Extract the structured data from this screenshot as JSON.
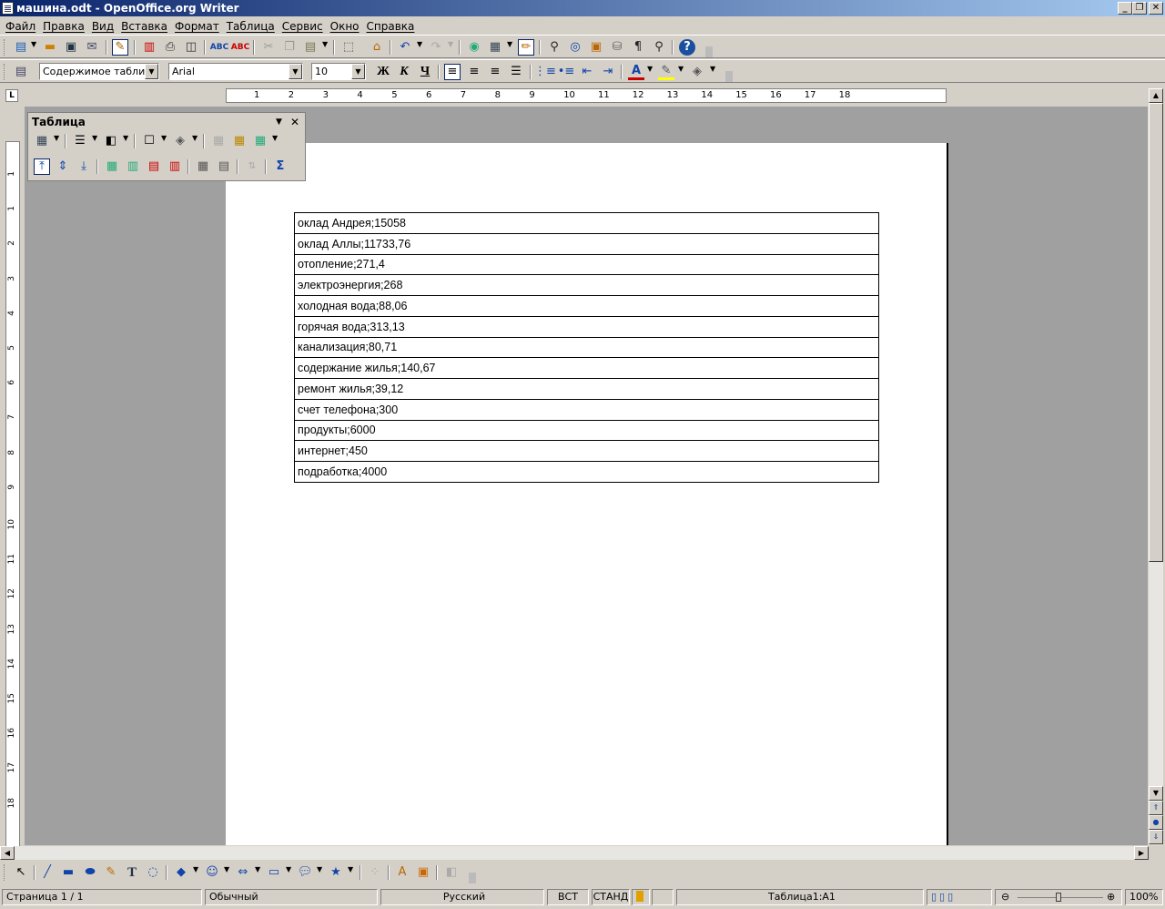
{
  "window": {
    "title": "машина.odt - OpenOffice.org Writer",
    "minimize": "_",
    "restore": "❐",
    "close": "✕"
  },
  "menu": [
    "Файл",
    "Правка",
    "Вид",
    "Вставка",
    "Формат",
    "Таблица",
    "Сервис",
    "Окно",
    "Справка"
  ],
  "standard_toolbar": {
    "icons": [
      "new-icon",
      "open-icon",
      "save-icon",
      "email-icon",
      "edit-icon",
      "pdf-icon",
      "print-icon",
      "preview-icon",
      "spellcheck-icon",
      "autospell-icon",
      "cut-icon",
      "copy-icon",
      "paste-icon",
      "clone-icon",
      "undo-icon",
      "redo-icon",
      "hyperlink-icon",
      "table-icon",
      "drawing-icon",
      "find-icon",
      "navigator-icon",
      "gallery-icon",
      "datasource-icon",
      "nonprint-icon",
      "zoom-icon",
      "help-icon"
    ]
  },
  "format_toolbar": {
    "paragraph_style": "Содержимое таблицы",
    "font_name": "Arial",
    "font_size": "10",
    "bold": "Ж",
    "italic": "К",
    "underline": "Ч",
    "font_color": "#cc0000",
    "highlight_color": "#ffff00"
  },
  "ruler": {
    "h_ticks": [
      "1",
      "2",
      "3",
      "4",
      "5",
      "6",
      "7",
      "8",
      "9",
      "10",
      "11",
      "12",
      "13",
      "14",
      "15",
      "16",
      "17",
      "18"
    ],
    "v_ticks": [
      "1",
      "1",
      "2",
      "3",
      "4",
      "5",
      "6",
      "7",
      "8",
      "9",
      "10",
      "11",
      "12",
      "13",
      "14",
      "15",
      "16",
      "17",
      "18"
    ]
  },
  "table_panel": {
    "title": "Таблица",
    "close": "✕"
  },
  "document": {
    "rows": [
      "оклад Андрея;15058",
      "оклад Аллы;11733,76",
      "отопление;271,4",
      "электроэнергия;268",
      "холодная вода;88,06",
      "горячая вода;313,13",
      "канализация;80,71",
      "содержание жилья;140,67",
      "ремонт жилья;39,12",
      "счет телефона;300",
      "продукты;6000",
      "интернет;450",
      "подработка;4000"
    ]
  },
  "status": {
    "page": "Страница  1 / 1",
    "style": "Обычный",
    "language": "Русский",
    "insert_mode": "ВСТ",
    "selection_mode": "СТАНД",
    "cell": "Таблица1:A1",
    "zoom": "100%"
  }
}
